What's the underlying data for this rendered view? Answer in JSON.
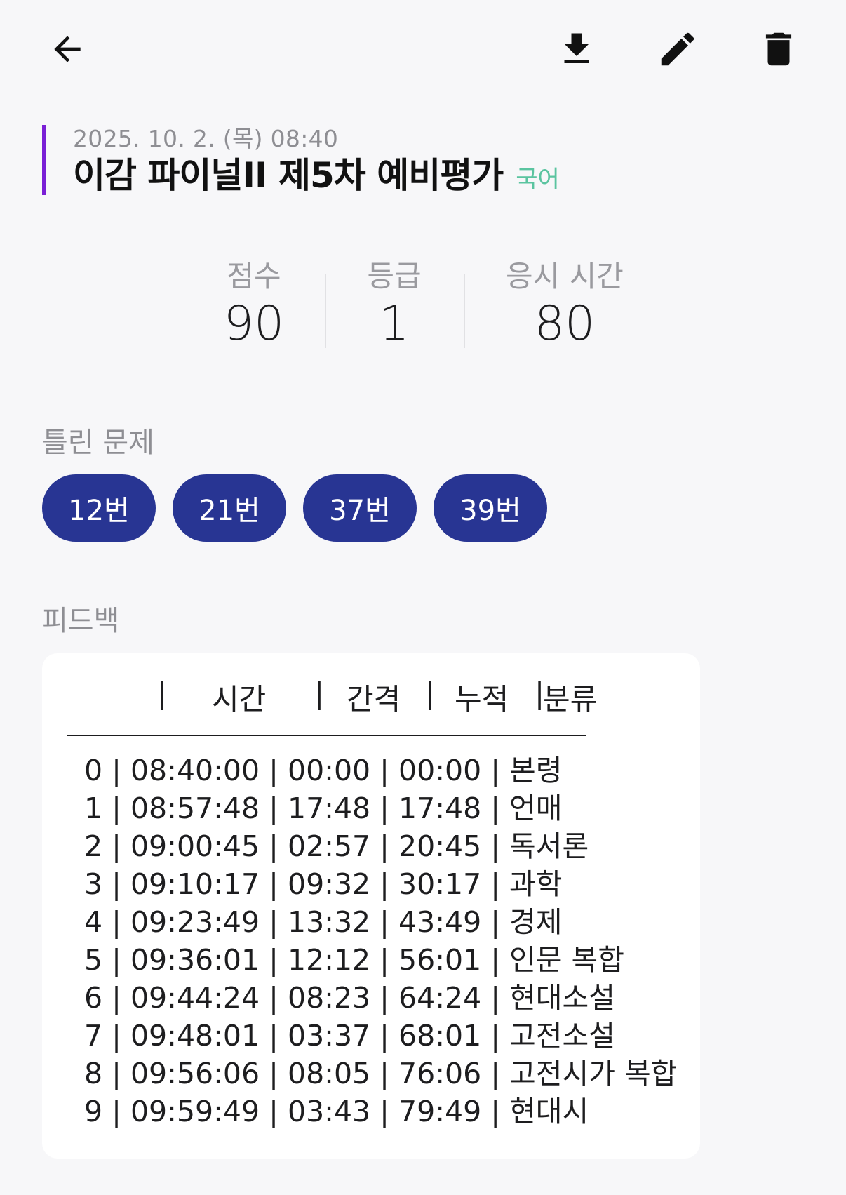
{
  "toolbar": {
    "back": "arrow-left-icon",
    "download": "download-icon",
    "edit": "pencil-icon",
    "delete": "trash-icon"
  },
  "exam": {
    "datetime": "2025. 10. 2. (목) 08:40",
    "title": "이감 파이널II 제5차 예비평가",
    "subject": "국어"
  },
  "stats": {
    "score_label": "점수",
    "score_value": "90",
    "grade_label": "등급",
    "grade_value": "1",
    "time_label": "응시 시간",
    "time_value": "80"
  },
  "wrong": {
    "label": "틀린 문제",
    "items": [
      "12번",
      "21번",
      "37번",
      "39번"
    ]
  },
  "feedback": {
    "label": "피드백",
    "header": {
      "sep1": "|",
      "time": "시간",
      "sep2": "|",
      "interval": "간격",
      "sep3": "|",
      "cumulative": "누적",
      "sep4": "|",
      "category": "분류"
    },
    "rows": [
      "0 | 08:40:00 | 00:00 | 00:00 | 본령",
      "1 | 08:57:48 | 17:48 | 17:48 | 언매",
      "2 | 09:00:45 | 02:57 | 20:45 | 독서론",
      "3 | 09:10:17 | 09:32 | 30:17 | 과학",
      "4 | 09:23:49 | 13:32 | 43:49 | 경제",
      "5 | 09:36:01 | 12:12 | 56:01 | 인문 복합",
      "6 | 09:44:24 | 08:23 | 64:24 | 현대소설",
      "7 | 09:48:01 | 03:37 | 68:01 | 고전소설",
      "8 | 09:56:06 | 08:05 | 76:06 | 고전시가 복합",
      "9 | 09:59:49 | 03:43 | 79:49 | 현대시"
    ]
  },
  "colors": {
    "accent_bar": "#7a1fd6",
    "chip_bg": "#283593",
    "subject": "#5bc4a0",
    "background": "#f7f7f9"
  }
}
